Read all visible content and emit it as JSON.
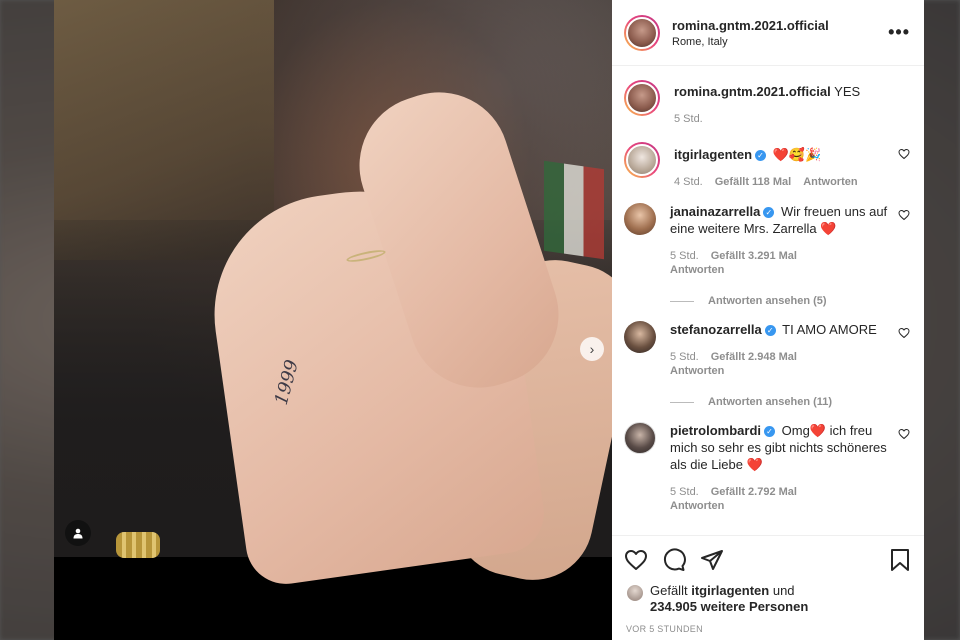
{
  "post": {
    "username": "romina.gntm.2021.official",
    "location": "Rome, Italy",
    "caption_user": "romina.gntm.2021.official",
    "caption": "YES",
    "caption_time": "5 Std.",
    "tattoo": "1999"
  },
  "comments": [
    {
      "user": "itgirlagenten",
      "verified": true,
      "text": "❤️🥰🎉",
      "time": "4 Std.",
      "likes": "Gefällt 118 Mal",
      "reply": "Antworten"
    },
    {
      "user": "janainazarrella",
      "verified": true,
      "text": "Wir freuen uns auf eine weitere Mrs. Zarrella ❤️",
      "time": "5 Std.",
      "likes": "Gefällt 3.291 Mal",
      "reply": "Antworten",
      "view_replies": "Antworten ansehen (5)"
    },
    {
      "user": "stefanozarrella",
      "verified": true,
      "text": "TI AMO AMORE",
      "time": "5 Std.",
      "likes": "Gefällt 2.948 Mal",
      "reply": "Antworten",
      "view_replies": "Antworten ansehen (11)"
    },
    {
      "user": "pietrolombardi",
      "verified": true,
      "text": "Omg❤️ ich freu mich so sehr es gibt nichts schöneres als die Liebe ❤️",
      "time": "5 Std.",
      "likes": "Gefällt 2.792 Mal",
      "reply": "Antworten"
    }
  ],
  "likes": {
    "prefix": "Gefällt",
    "user": "itgirlagenten",
    "middle": "und",
    "count": "234.905 weitere Personen"
  },
  "timestamp": "VOR 5 STUNDEN",
  "icons": {
    "more": "more-horizontal-icon",
    "next": "chevron-right-icon",
    "tag": "user-tag-icon",
    "like": "heart-icon",
    "comment": "comment-icon",
    "share": "paper-plane-icon",
    "save": "bookmark-icon"
  },
  "colors": {
    "verified": "#3897f0",
    "text": "#262626",
    "muted": "#8e8e8e",
    "heart_red": "#ed4956"
  }
}
